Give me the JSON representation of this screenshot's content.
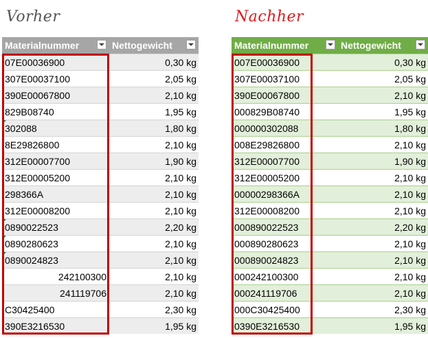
{
  "headings": {
    "left": "Vorher",
    "right": "Nachher"
  },
  "columns": {
    "material": "Materialnummer",
    "weight": "Nettogewicht"
  },
  "before": [
    {
      "mat": "07E00036900",
      "w": "0,30 kg",
      "tri": false,
      "align": "left"
    },
    {
      "mat": "307E00037100",
      "w": "2,05 kg",
      "tri": false,
      "align": "left"
    },
    {
      "mat": "390E00067800",
      "w": "2,10 kg",
      "tri": false,
      "align": "left"
    },
    {
      "mat": "829B08740",
      "w": "1,95 kg",
      "tri": false,
      "align": "left"
    },
    {
      "mat": "302088",
      "w": "1,80 kg",
      "tri": true,
      "align": "left"
    },
    {
      "mat": "8E29826800",
      "w": "2,10 kg",
      "tri": false,
      "align": "left"
    },
    {
      "mat": "312E00007700",
      "w": "1,90 kg",
      "tri": false,
      "align": "left"
    },
    {
      "mat": "312E00005200",
      "w": "2,10 kg",
      "tri": false,
      "align": "left"
    },
    {
      "mat": "298366A",
      "w": "2,10 kg",
      "tri": false,
      "align": "left"
    },
    {
      "mat": "312E00008200",
      "w": "2,10 kg",
      "tri": false,
      "align": "left"
    },
    {
      "mat": "0890022523",
      "w": "2,20 kg",
      "tri": true,
      "align": "left"
    },
    {
      "mat": "0890280623",
      "w": "2,10 kg",
      "tri": true,
      "align": "left"
    },
    {
      "mat": "0890024823",
      "w": "2,10 kg",
      "tri": true,
      "align": "left"
    },
    {
      "mat": "242100300",
      "w": "2,10 kg",
      "tri": false,
      "align": "right"
    },
    {
      "mat": "241119706",
      "w": "2,10 kg",
      "tri": false,
      "align": "right"
    },
    {
      "mat": "C30425400",
      "w": "2,30 kg",
      "tri": false,
      "align": "left"
    },
    {
      "mat": "390E3216530",
      "w": "1,95 kg",
      "tri": false,
      "align": "left"
    }
  ],
  "after": [
    {
      "mat": "007E00036900",
      "w": "0,30 kg"
    },
    {
      "mat": "307E00037100",
      "w": "2,05 kg"
    },
    {
      "mat": "390E00067800",
      "w": "2,10 kg"
    },
    {
      "mat": "000829B08740",
      "w": "1,95 kg"
    },
    {
      "mat": "000000302088",
      "w": "1,80 kg"
    },
    {
      "mat": "008E29826800",
      "w": "2,10 kg"
    },
    {
      "mat": "312E00007700",
      "w": "1,90 kg"
    },
    {
      "mat": "312E00005200",
      "w": "2,10 kg"
    },
    {
      "mat": "00000298366A",
      "w": "2,10 kg"
    },
    {
      "mat": "312E00008200",
      "w": "2,10 kg"
    },
    {
      "mat": "000890022523",
      "w": "2,20 kg"
    },
    {
      "mat": "000890280623",
      "w": "2,10 kg"
    },
    {
      "mat": "000890024823",
      "w": "2,10 kg"
    },
    {
      "mat": "000242100300",
      "w": "2,10 kg"
    },
    {
      "mat": "000241119706",
      "w": "2,10 kg"
    },
    {
      "mat": "000C30425400",
      "w": "2,30 kg"
    },
    {
      "mat": "0390E3216530",
      "w": "1,95 kg"
    }
  ]
}
